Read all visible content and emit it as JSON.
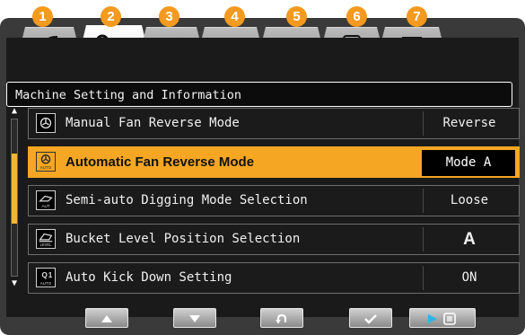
{
  "badges": [
    "1",
    "2",
    "3",
    "4",
    "5",
    "6",
    "7"
  ],
  "tabs": [
    {
      "icon": "leaf-icon",
      "active": false
    },
    {
      "icon": "machine-settings-icon",
      "active": true
    },
    {
      "icon": "tool-arrow-icon",
      "active": false
    },
    {
      "icon": "heat-icon",
      "active": false
    },
    {
      "icon": "gear-box-icon",
      "active": false
    },
    {
      "icon": "list-icon",
      "active": false
    },
    {
      "icon": "mail-icon",
      "active": false
    }
  ],
  "screen_title": "Machine Setting and Information",
  "rows": [
    {
      "label": "Manual Fan Reverse Mode",
      "value": "Reverse",
      "icon": "fan-icon",
      "icon_text": "",
      "selected": false
    },
    {
      "label": "Automatic Fan Reverse Mode",
      "value": "Mode A",
      "icon": "fan-auto-icon",
      "icon_text": "AUTO",
      "selected": true
    },
    {
      "label": "Semi-auto Digging Mode Selection",
      "value": "Loose",
      "icon": "digging-auto-icon",
      "icon_text": "AUT",
      "selected": false
    },
    {
      "label": "Bucket Level Position Selection",
      "value": "A",
      "icon": "bucket-level-icon",
      "icon_text": "LEVEL",
      "selected": false
    },
    {
      "label": "Auto Kick Down Setting",
      "value": "ON",
      "icon": "kick-down-icon",
      "icon_text": "AUTO",
      "selected": false
    }
  ],
  "scroll_position": 0.4,
  "buttons": [
    {
      "name": "up-button",
      "icon": "triangle-up-icon"
    },
    {
      "name": "down-button",
      "icon": "triangle-down-icon"
    },
    {
      "name": "back-button",
      "icon": "return-arrow-icon"
    },
    {
      "name": "confirm-button",
      "icon": "checkmark-icon"
    },
    {
      "name": "menu-button",
      "icon": "play-list-icon"
    }
  ],
  "colors": {
    "accent": "#f5a623",
    "badge": "#f39a1f",
    "highlight_blue": "#2cb6e6"
  }
}
